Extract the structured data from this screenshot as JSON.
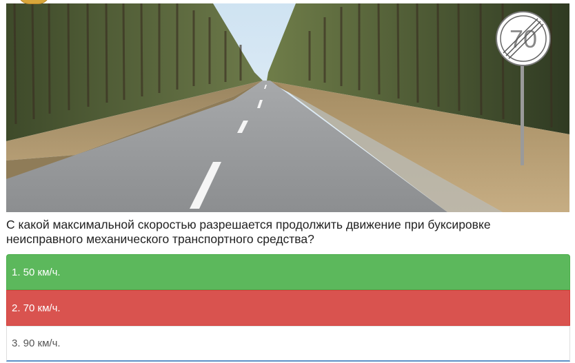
{
  "question": {
    "text": "С какой максимальной скоростью разрешается продолжить движение при буксировке неисправного механического транспортного средства?"
  },
  "sign": {
    "value": "70",
    "meaning": "end-of-speed-limit-sign"
  },
  "answers": [
    {
      "label": "1. 50 км/ч.",
      "state": "correct",
      "color": "#5cb85c"
    },
    {
      "label": "2. 70 км/ч.",
      "state": "wrong",
      "color": "#d9534f"
    },
    {
      "label": "3. 90 км/ч.",
      "state": "neutral",
      "color": "#ffffff"
    }
  ]
}
